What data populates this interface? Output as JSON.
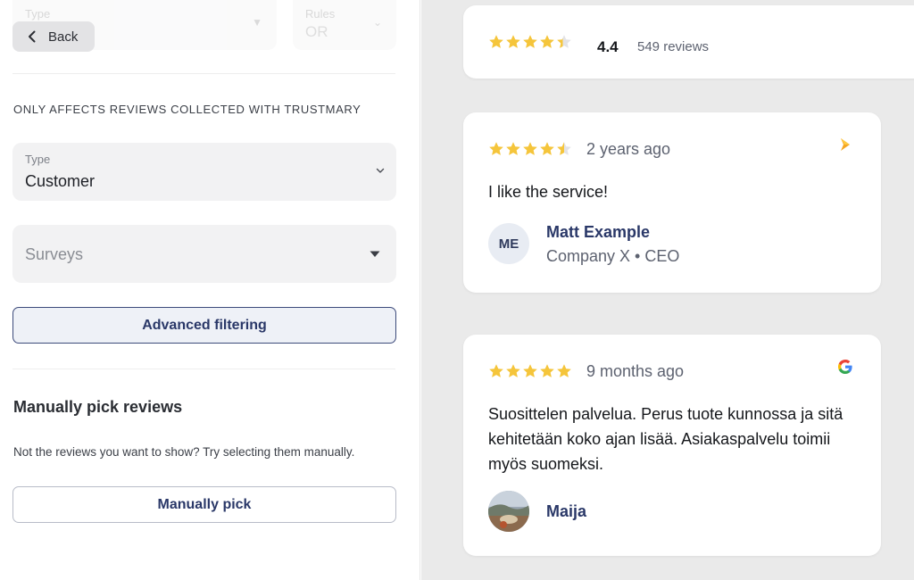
{
  "colors": {
    "accent": "#2a3868",
    "star": "#f5c53b",
    "star_empty": "#e3e3e6",
    "panel_bg": "#eaeaea"
  },
  "top_filters": {
    "left_label": "Type",
    "right_label": "Rules",
    "right_value": "OR"
  },
  "back_button": {
    "label": "Back",
    "icon": "chevron-left-icon"
  },
  "filters": {
    "heading": "ONLY AFFECTS REVIEWS COLLECTED WITH TRUSTMARY",
    "type_select": {
      "label": "Type",
      "value": "Customer",
      "icon": "chevron-down-icon"
    },
    "surveys_select": {
      "placeholder": "Surveys",
      "icon": "caret-down-icon"
    },
    "advanced_button": "Advanced filtering"
  },
  "manual": {
    "title": "Manually pick reviews",
    "description": "Not the reviews you want to show? Try selecting them manually.",
    "button": "Manually pick"
  },
  "summary": {
    "stars": 4.4,
    "rating": "4.4",
    "count": "549 reviews"
  },
  "reviews": [
    {
      "stars": 4.5,
      "age": "2 years ago",
      "source_icon": "trustmary-logo-icon",
      "text": "I like the service!",
      "author": "Matt Example",
      "initials": "ME",
      "company": "Company X • CEO"
    },
    {
      "stars": 5,
      "age": "9 months ago",
      "source_icon": "google-logo-icon",
      "text": "Suosittelen palvelua. Perus tuote kunnossa ja sitä kehitetään koko ajan lisää. Asiakaspalvelu toimii myös suomeksi.",
      "author": "Maija",
      "avatar": "photo-avatar"
    }
  ]
}
